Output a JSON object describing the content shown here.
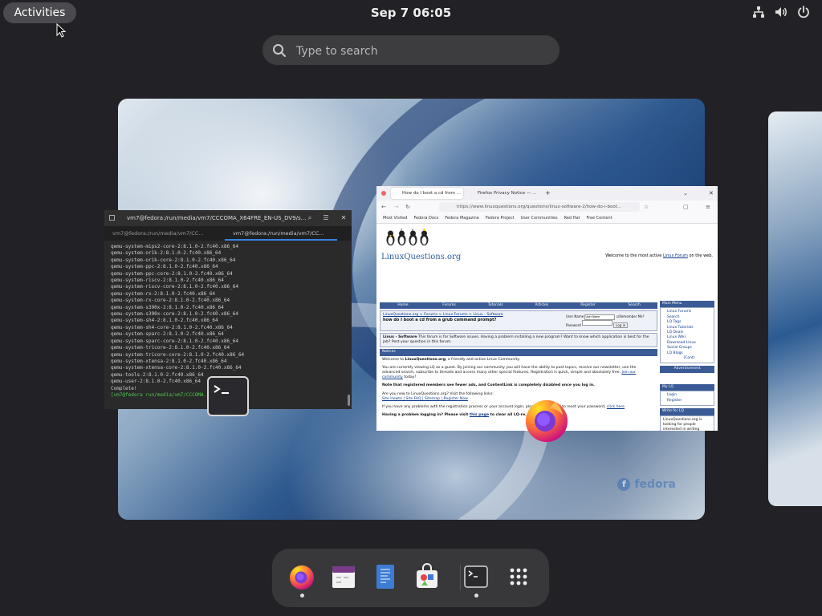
{
  "topbar": {
    "activities_label": "Activities",
    "clock": "Sep 7  06:05",
    "tray_icons": [
      "network-icon",
      "volume-icon",
      "power-icon"
    ]
  },
  "search": {
    "placeholder": "Type to search"
  },
  "terminal": {
    "title": "vm7@fedora:/run/media/vm7/CCCOMA_X64FRE_EN-US_DV9/s...",
    "tabs": [
      "vm7@fedora:/run/media/vm7/CC...",
      "vm7@fedora:/run/media/vm7/CC..."
    ],
    "lines": [
      "qemu-system-mips2-core-2:8.1.0-2.fc40.x86_64",
      "qemu-system-or1k-2:8.1.0-2.fc40.x86_64",
      "qemu-system-or1k-core-2:8.1.0-2.fc40.x86_64",
      "qemu-system-ppc-2:8.1.0-2.fc40.x86_64",
      "qemu-system-ppc-core-2:8.1.0-2.fc40.x86_64",
      "qemu-system-riscv-2:8.1.0-2.fc40.x86_64",
      "qemu-system-riscv-core-2:8.1.0-2.fc40.x86_64",
      "qemu-system-rx-2:8.1.0-2.fc40.x86_64",
      "qemu-system-rx-core-2:8.1.0-2.fc40.x86_64",
      "qemu-system-s390x-2:8.1.0-2.fc40.x86_64",
      "qemu-system-s390x-core-2:8.1.0-2.fc40.x86_64",
      "qemu-system-sh4-2:8.1.0-2.fc40.x86_64",
      "qemu-system-sh4-core-2:8.1.0-2.fc40.x86_64",
      "qemu-system-sparc-2:8.1.0-2.fc40.x86_64",
      "qemu-system-sparc-core-2:8.1.0-2.fc40.x86_64",
      "qemu-system-tricore-2:8.1.0-2.fc40.x86_64",
      "qemu-system-tricore-core-2:8.1.0-2.fc40.x86_64",
      "qemu-system-xtensa-2:8.1.0-2.fc40.x86_64",
      "qemu-system-xtensa-core-2:8.1.0-2.fc40.x86_64",
      "qemu-tools-2:8.1.0-2.fc40.x86_64",
      "qemu-user-2:8.1.0-2.fc40.x86_64",
      "",
      "Complete!"
    ],
    "prompt": "[vm7@fedora run/media/vm7/CCCOMA...]$"
  },
  "firefox": {
    "tabs": [
      "How do I boot a cd from ...",
      "Firefox Privacy Notice — ..."
    ],
    "url": "https://www.linuxquestions.org/questions/linux-software-2/how-do-i-boot...",
    "bookmarks": [
      "Most Visited",
      "Fedora Docs",
      "Fedora Magazine",
      "Fedora Project",
      "User Communities",
      "Red Hat",
      "Free Content"
    ],
    "page": {
      "logo": "LinuxQuestions.org",
      "welcome_prefix": "Welcome to the most active",
      "welcome_link": "Linux Forum",
      "welcome_suffix": "on the web.",
      "nav": [
        "Home",
        "Forums",
        "Tutorials",
        "Articles",
        "Register",
        "Search"
      ],
      "breadcrumb": "LinuxQuestions.org > Forums > Linux Forums > Linux - Software",
      "thread_title": "how do I boot a cd from a grub command prompt?",
      "forum_name": "Linux - Software",
      "forum_desc": "This forum is for Software issues. Having a problem installing a new program? Want to know which application is best for the job? Post your question in this forum.",
      "notices_head": "Notices",
      "welcome_para_a": "Welcome to",
      "welcome_para_site": "LinuxQuestions.org",
      "welcome_para_b": ", a friendly and active Linux Community.",
      "guest_text": "You are currently viewing LQ as a guest. By joining our community you will have the ability to post topics, receive our newsletter, use the advanced search, subscribe to threads and access many other special features. Registration is quick, simple and absolutely free.",
      "join_link": "Join our community",
      "join_suffix": "today!",
      "note": "Note that registered members see fewer ads, and ContentLink is completely disabled once you log in.",
      "new_q": "Are you new to LinuxQuestions.org? Visit the following links:",
      "new_links": "Site Howto | Site FAQ | Sitemap | Register Now",
      "problems_a": "If you have any problems with the registration process or your account login, please",
      "problems_b": ". If you need to reset your password,",
      "click_here": "click here",
      "having_problem": "Having a problem logging in? Please visit",
      "this_page": "this page",
      "to_clear": "to clear all LQ-re...",
      "login_user": "User Name",
      "login_user_value": "User Name",
      "login_pass": "Password",
      "remember": "Remember Me?",
      "login_btn": "Log in",
      "sidebar_head": "Main Menu",
      "sidebar_links": [
        "Linux Forums",
        "Search",
        "LQ Tags",
        "Linux Tutorials",
        "LQ Deals",
        "Linux Wiki",
        "Download Linux",
        "Social Groups",
        "LQ Blogs"
      ],
      "sidebar_more": "(Cont)",
      "ad_head": "Advertisement",
      "mylq_head": "My LQ",
      "mylq_links": [
        "Login",
        "Register"
      ],
      "write_head": "Write for LQ",
      "write_text": "LinuxQuestions.org is looking for people interested in writing"
    }
  },
  "workspace": {
    "brand": "fedora"
  },
  "dash": {
    "apps": [
      {
        "name": "Firefox",
        "running": true
      },
      {
        "name": "Calendar",
        "running": false
      },
      {
        "name": "Text Editor",
        "running": false
      },
      {
        "name": "Software",
        "running": false
      },
      {
        "name": "Terminal",
        "running": true
      },
      {
        "name": "Show Apps",
        "running": false
      }
    ]
  },
  "colors": {
    "panel": "#222226",
    "dash": "#38383b",
    "accent": "#3584e4",
    "lq_blue": "#3a5b95"
  }
}
